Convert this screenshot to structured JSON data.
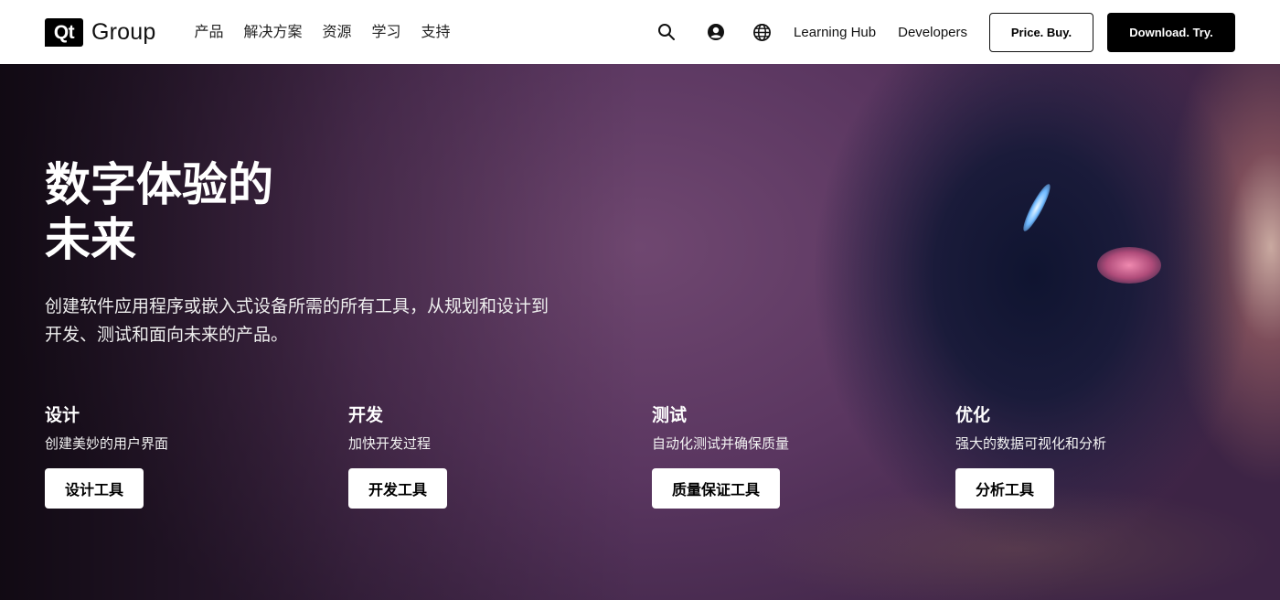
{
  "header": {
    "logo_mark": "Qt",
    "logo_word": "Group",
    "nav": [
      "产品",
      "解决方案",
      "资源",
      "学习",
      "支持"
    ],
    "learning_hub": "Learning Hub",
    "developers": "Developers",
    "price_button": "Price. Buy.",
    "download_button": "Download. Try.",
    "icons": [
      "search-icon",
      "user-icon",
      "globe-icon"
    ]
  },
  "hero": {
    "title_line1": "数字体验的",
    "title_line2": "未来",
    "subtitle_line1": "创建软件应用程序或嵌入式设备所需的所有工具，从规划和设计到",
    "subtitle_line2": "开发、测试和面向未来的产品。",
    "pillars": [
      {
        "title": "设计",
        "desc": "创建美妙的用户界面",
        "button": "设计工具"
      },
      {
        "title": "开发",
        "desc": "加快开发过程",
        "button": "开发工具"
      },
      {
        "title": "测试",
        "desc": "自动化测试并确保质量",
        "button": "质量保证工具"
      },
      {
        "title": "优化",
        "desc": "强大的数据可视化和分析",
        "button": "分析工具"
      }
    ]
  },
  "colors": {
    "header_bg": "#ffffff",
    "primary_button_bg": "#000000",
    "hero_accent": "#5a3660"
  }
}
